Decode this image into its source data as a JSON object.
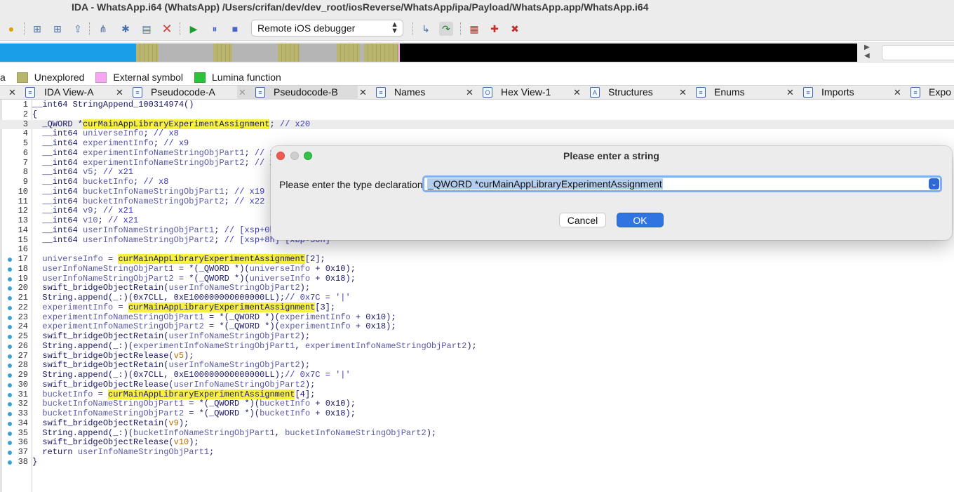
{
  "window": {
    "title": "IDA - WhatsApp.i64 (WhatsApp) /Users/crifan/dev/dev_root/iosReverse/WhatsApp/ipa/Payload/WhatsApp.app/WhatsApp.i64"
  },
  "toolbar": {
    "debugger_select": "Remote iOS debugger",
    "icons": [
      "lightbulb-icon",
      "add-segment-icon",
      "add-struct-icon",
      "export-icon",
      "graph-icon",
      "network-icon",
      "folder-icon",
      "delete-icon",
      "play-icon",
      "pause-icon",
      "stop-icon",
      "step-into-icon",
      "step-over-icon",
      "breakpoint-list-icon",
      "add-breakpoint-icon",
      "remove-breakpoint-icon"
    ]
  },
  "navbar": {
    "colors": {
      "code": "#1a9ee6",
      "unexplored": "#b9b56e",
      "data": "#b5b5b5",
      "external": "#f5a8f0",
      "black": "#000000"
    },
    "segments": [
      {
        "kind": "code",
        "share": 0.159
      },
      {
        "kind": "unexplored",
        "share": 0.026
      },
      {
        "kind": "data",
        "share": 0.064
      },
      {
        "kind": "unexplored",
        "share": 0.022
      },
      {
        "kind": "data",
        "share": 0.053
      },
      {
        "kind": "unexplored",
        "share": 0.025
      },
      {
        "kind": "data",
        "share": 0.043
      },
      {
        "kind": "unexplored",
        "share": 0.027
      },
      {
        "kind": "data",
        "share": 0.005
      },
      {
        "kind": "unexplored",
        "share": 0.04
      },
      {
        "kind": "external",
        "share": 0.002
      },
      {
        "kind": "black",
        "share": 0.534
      }
    ]
  },
  "legend": {
    "leading": "a",
    "items": [
      {
        "label": "Unexplored",
        "color": "#b9b56e"
      },
      {
        "label": "External symbol",
        "color": "#f5a8f0"
      },
      {
        "label": "Lumina function",
        "color": "#2ec23a"
      }
    ]
  },
  "tabs": [
    {
      "label": "IDA View-A",
      "icon": "disassembly-icon",
      "glyph": "≡"
    },
    {
      "label": "Pseudocode-A",
      "icon": "pseudocode-icon",
      "glyph": "≡"
    },
    {
      "label": "Pseudocode-B",
      "icon": "pseudocode-icon",
      "glyph": "≡",
      "active": true
    },
    {
      "label": "Names",
      "icon": "names-icon",
      "glyph": "≡"
    },
    {
      "label": "Hex View-1",
      "icon": "hex-icon",
      "glyph": "O"
    },
    {
      "label": "Structures",
      "icon": "structures-icon",
      "glyph": "A"
    },
    {
      "label": "Enums",
      "icon": "enums-icon",
      "glyph": "≡"
    },
    {
      "label": "Imports",
      "icon": "imports-icon",
      "glyph": "≡"
    },
    {
      "label": "Expo",
      "icon": "exports-icon",
      "glyph": "≡"
    }
  ],
  "code": {
    "lines": [
      {
        "n": "1",
        "bp": false,
        "parts": [
          [
            "kw",
            "__int64 StringAppend_100314974()"
          ]
        ]
      },
      {
        "n": "2",
        "bp": false,
        "parts": [
          [
            "kw",
            "{"
          ]
        ]
      },
      {
        "n": "3",
        "bp": false,
        "cur": true,
        "parts": [
          [
            "kw",
            "  _QWORD *"
          ],
          [
            "hl",
            "curMainAppLibraryExperimentAssignment"
          ],
          [
            "kw",
            "; "
          ],
          [
            "cmt",
            "// x20"
          ]
        ]
      },
      {
        "n": "4",
        "bp": false,
        "parts": [
          [
            "kw",
            "  __int64 "
          ],
          [
            "var",
            "universeInfo"
          ],
          [
            "kw",
            "; "
          ],
          [
            "cmt",
            "// x8"
          ]
        ]
      },
      {
        "n": "5",
        "bp": false,
        "parts": [
          [
            "kw",
            "  __int64 "
          ],
          [
            "var",
            "experimentInfo"
          ],
          [
            "kw",
            "; "
          ],
          [
            "cmt",
            "// x9"
          ]
        ]
      },
      {
        "n": "6",
        "bp": false,
        "parts": [
          [
            "kw",
            "  __int64 "
          ],
          [
            "var",
            "experimentInfoNameStringObjPart1"
          ],
          [
            "kw",
            "; "
          ],
          [
            "cmt",
            "// x"
          ]
        ]
      },
      {
        "n": "7",
        "bp": false,
        "parts": [
          [
            "kw",
            "  __int64 "
          ],
          [
            "var",
            "experimentInfoNameStringObjPart2"
          ],
          [
            "kw",
            "; "
          ],
          [
            "cmt",
            "// x"
          ]
        ]
      },
      {
        "n": "8",
        "bp": false,
        "parts": [
          [
            "kw",
            "  __int64 "
          ],
          [
            "var",
            "v5"
          ],
          [
            "kw",
            "; "
          ],
          [
            "cmt",
            "// x21"
          ]
        ]
      },
      {
        "n": "9",
        "bp": false,
        "parts": [
          [
            "kw",
            "  __int64 "
          ],
          [
            "var",
            "bucketInfo"
          ],
          [
            "kw",
            "; "
          ],
          [
            "cmt",
            "// x8"
          ]
        ]
      },
      {
        "n": "10",
        "bp": false,
        "parts": [
          [
            "kw",
            "  __int64 "
          ],
          [
            "var",
            "bucketInfoNameStringObjPart1"
          ],
          [
            "kw",
            "; "
          ],
          [
            "cmt",
            "// x19"
          ]
        ]
      },
      {
        "n": "11",
        "bp": false,
        "parts": [
          [
            "kw",
            "  __int64 "
          ],
          [
            "var",
            "bucketInfoNameStringObjPart2"
          ],
          [
            "kw",
            "; "
          ],
          [
            "cmt",
            "// x22"
          ]
        ]
      },
      {
        "n": "12",
        "bp": false,
        "parts": [
          [
            "kw",
            "  __int64 "
          ],
          [
            "var",
            "v9"
          ],
          [
            "kw",
            "; "
          ],
          [
            "cmt",
            "// x21"
          ]
        ]
      },
      {
        "n": "13",
        "bp": false,
        "parts": [
          [
            "kw",
            "  __int64 "
          ],
          [
            "var",
            "v10"
          ],
          [
            "kw",
            "; "
          ],
          [
            "cmt",
            "// x21"
          ]
        ]
      },
      {
        "n": "14",
        "bp": false,
        "parts": [
          [
            "kw",
            "  __int64 "
          ],
          [
            "var",
            "userInfoNameStringObjPart1"
          ],
          [
            "kw",
            "; "
          ],
          [
            "cmt",
            "// [xsp+0h"
          ]
        ]
      },
      {
        "n": "15",
        "bp": false,
        "parts": [
          [
            "kw",
            "  __int64 "
          ],
          [
            "var",
            "userInfoNameStringObjPart2"
          ],
          [
            "kw",
            "; "
          ],
          [
            "cmt",
            "// [xsp+8h] [xbp-30h]"
          ]
        ]
      },
      {
        "n": "16",
        "bp": false,
        "parts": [
          [
            "kw",
            ""
          ]
        ]
      },
      {
        "n": "17",
        "bp": true,
        "parts": [
          [
            "var",
            "  universeInfo"
          ],
          [
            "kw",
            " = "
          ],
          [
            "hl",
            "curMainAppLibraryExperimentAssignment"
          ],
          [
            "kw",
            "[2];"
          ]
        ]
      },
      {
        "n": "18",
        "bp": true,
        "parts": [
          [
            "var",
            "  userInfoNameStringObjPart1"
          ],
          [
            "kw",
            " = *(_QWORD *)("
          ],
          [
            "var",
            "universeInfo"
          ],
          [
            "kw",
            " + 0x10);"
          ]
        ]
      },
      {
        "n": "19",
        "bp": true,
        "parts": [
          [
            "var",
            "  userInfoNameStringObjPart2"
          ],
          [
            "kw",
            " = *(_QWORD *)("
          ],
          [
            "var",
            "universeInfo"
          ],
          [
            "kw",
            " + 0x18);"
          ]
        ]
      },
      {
        "n": "20",
        "bp": true,
        "parts": [
          [
            "kw",
            "  swift_bridgeObjectRetain("
          ],
          [
            "var",
            "userInfoNameStringObjPart2"
          ],
          [
            "kw",
            ");"
          ]
        ]
      },
      {
        "n": "21",
        "bp": true,
        "parts": [
          [
            "kw",
            "  String.append(_:)(0x7CLL, 0xE100000000000000LL);"
          ],
          [
            "cmt",
            "// 0x7C = '|'"
          ]
        ]
      },
      {
        "n": "22",
        "bp": true,
        "parts": [
          [
            "var",
            "  experimentInfo"
          ],
          [
            "kw",
            " = "
          ],
          [
            "hl",
            "curMainAppLibraryExperimentAssignment"
          ],
          [
            "kw",
            "[3];"
          ]
        ]
      },
      {
        "n": "23",
        "bp": true,
        "parts": [
          [
            "var",
            "  experimentInfoNameStringObjPart1"
          ],
          [
            "kw",
            " = *(_QWORD *)("
          ],
          [
            "var",
            "experimentInfo"
          ],
          [
            "kw",
            " + 0x10);"
          ]
        ]
      },
      {
        "n": "24",
        "bp": true,
        "parts": [
          [
            "var",
            "  experimentInfoNameStringObjPart2"
          ],
          [
            "kw",
            " = *(_QWORD *)("
          ],
          [
            "var",
            "experimentInfo"
          ],
          [
            "kw",
            " + 0x18);"
          ]
        ]
      },
      {
        "n": "25",
        "bp": true,
        "parts": [
          [
            "kw",
            "  swift_bridgeObjectRetain("
          ],
          [
            "var",
            "userInfoNameStringObjPart2"
          ],
          [
            "kw",
            ");"
          ]
        ]
      },
      {
        "n": "26",
        "bp": true,
        "parts": [
          [
            "kw",
            "  String.append(_:)("
          ],
          [
            "var",
            "experimentInfoNameStringObjPart1"
          ],
          [
            "kw",
            ", "
          ],
          [
            "var",
            "experimentInfoNameStringObjPart2"
          ],
          [
            "kw",
            ");"
          ]
        ]
      },
      {
        "n": "27",
        "bp": true,
        "parts": [
          [
            "kw",
            "  swift_bridgeObjectRelease("
          ],
          [
            "or",
            "v5"
          ],
          [
            "kw",
            ");"
          ]
        ]
      },
      {
        "n": "28",
        "bp": true,
        "parts": [
          [
            "kw",
            "  swift_bridgeObjectRetain("
          ],
          [
            "var",
            "userInfoNameStringObjPart2"
          ],
          [
            "kw",
            ");"
          ]
        ]
      },
      {
        "n": "29",
        "bp": true,
        "parts": [
          [
            "kw",
            "  String.append(_:)(0x7CLL, 0xE100000000000000LL);"
          ],
          [
            "cmt",
            "// 0x7C = '|'"
          ]
        ]
      },
      {
        "n": "30",
        "bp": true,
        "parts": [
          [
            "kw",
            "  swift_bridgeObjectRelease("
          ],
          [
            "var",
            "userInfoNameStringObjPart2"
          ],
          [
            "kw",
            ");"
          ]
        ]
      },
      {
        "n": "31",
        "bp": true,
        "parts": [
          [
            "var",
            "  bucketInfo"
          ],
          [
            "kw",
            " = "
          ],
          [
            "hl",
            "curMainAppLibraryExperimentAssignment"
          ],
          [
            "kw",
            "[4];"
          ]
        ]
      },
      {
        "n": "32",
        "bp": true,
        "parts": [
          [
            "var",
            "  bucketInfoNameStringObjPart1"
          ],
          [
            "kw",
            " = *(_QWORD *)("
          ],
          [
            "var",
            "bucketInfo"
          ],
          [
            "kw",
            " + 0x10);"
          ]
        ]
      },
      {
        "n": "33",
        "bp": true,
        "parts": [
          [
            "var",
            "  bucketInfoNameStringObjPart2"
          ],
          [
            "kw",
            " = *(_QWORD *)("
          ],
          [
            "var",
            "bucketInfo"
          ],
          [
            "kw",
            " + 0x18);"
          ]
        ]
      },
      {
        "n": "34",
        "bp": true,
        "parts": [
          [
            "kw",
            "  swift_bridgeObjectRetain("
          ],
          [
            "or",
            "v9"
          ],
          [
            "kw",
            ");"
          ]
        ]
      },
      {
        "n": "35",
        "bp": true,
        "parts": [
          [
            "kw",
            "  String.append(_:)("
          ],
          [
            "var",
            "bucketInfoNameStringObjPart1"
          ],
          [
            "kw",
            ", "
          ],
          [
            "var",
            "bucketInfoNameStringObjPart2"
          ],
          [
            "kw",
            ");"
          ]
        ]
      },
      {
        "n": "36",
        "bp": true,
        "parts": [
          [
            "kw",
            "  swift_bridgeObjectRelease("
          ],
          [
            "or",
            "v10"
          ],
          [
            "kw",
            ");"
          ]
        ]
      },
      {
        "n": "37",
        "bp": true,
        "parts": [
          [
            "kw",
            "  return "
          ],
          [
            "var",
            "userInfoNameStringObjPart1"
          ],
          [
            "kw",
            ";"
          ]
        ]
      },
      {
        "n": "38",
        "bp": true,
        "parts": [
          [
            "kw",
            "}"
          ]
        ]
      }
    ]
  },
  "dialog": {
    "title": "Please enter a string",
    "prompt": "Please enter the type declaration",
    "value": "_QWORD *curMainAppLibraryExperimentAssignment",
    "cancel_label": "Cancel",
    "ok_label": "OK"
  }
}
